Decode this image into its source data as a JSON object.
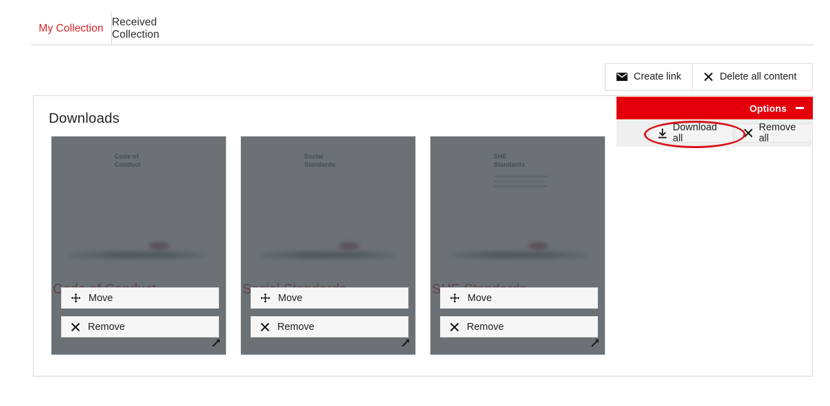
{
  "tabs": [
    {
      "label": "My Collection",
      "active": true,
      "name": "tab-my-collection"
    },
    {
      "label": "Received Collection",
      "active": false,
      "name": "tab-received-collection"
    }
  ],
  "top_actions": [
    {
      "label": "Create link",
      "icon": "envelope-icon"
    },
    {
      "label": "Delete all content",
      "icon": "close-x-icon"
    }
  ],
  "panel": {
    "title": "Downloads"
  },
  "options": {
    "label": "Options",
    "collapse_icon": "minus-icon",
    "items": [
      {
        "label": "Download all",
        "icon": "download-icon"
      },
      {
        "label": "Remove all",
        "icon": "close-x-icon"
      }
    ]
  },
  "annotation": {
    "shape": "ellipse",
    "target": "Download all",
    "color": "#d81219"
  },
  "cards": [
    {
      "title": "Code of Conduct",
      "thumb_title": "Code of\nConduct",
      "thumb_lines": 0,
      "menu": [
        {
          "label": "Move",
          "icon": "move-arrows-icon"
        },
        {
          "label": "Remove",
          "icon": "close-x-icon"
        }
      ],
      "resize_icon": "resize-diagonal-icon"
    },
    {
      "title": "Social Standards",
      "thumb_title": "Social\nStandards",
      "thumb_lines": 0,
      "menu": [
        {
          "label": "Move",
          "icon": "move-arrows-icon"
        },
        {
          "label": "Remove",
          "icon": "close-x-icon"
        }
      ],
      "resize_icon": "resize-diagonal-icon"
    },
    {
      "title": "SHE Standards",
      "thumb_title": "SHE\nStandards",
      "thumb_lines": 3,
      "menu": [
        {
          "label": "Move",
          "icon": "move-arrows-icon"
        },
        {
          "label": "Remove",
          "icon": "close-x-icon"
        }
      ],
      "resize_icon": "resize-diagonal-icon"
    }
  ],
  "colors": {
    "brand_red": "#e3000b",
    "tab_active_red": "#d8232a",
    "card_title_red": "#c8102e",
    "overlay_gray": "#5e6366",
    "annotation_red": "#d81219"
  }
}
